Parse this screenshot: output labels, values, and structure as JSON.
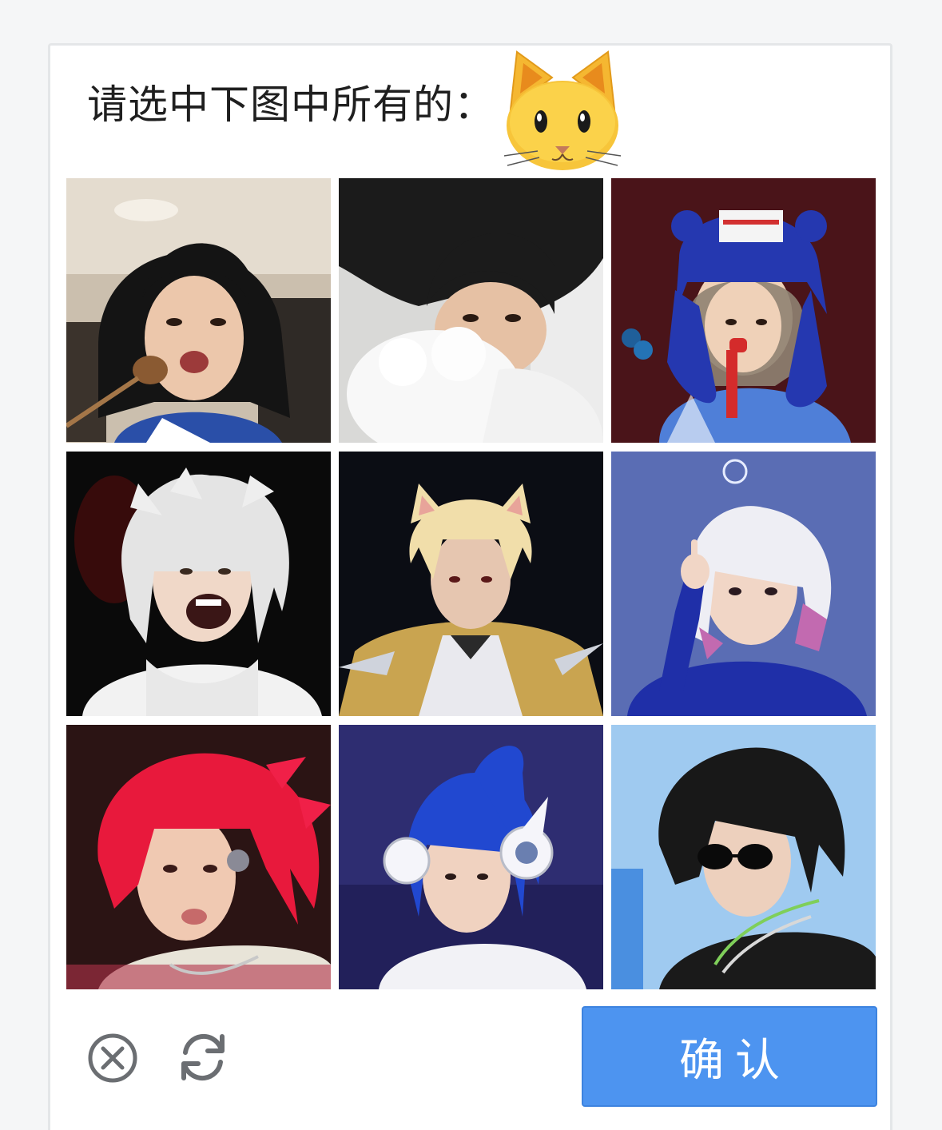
{
  "captcha": {
    "prompt": "请选中下图中所有的：",
    "target_icon": "cat-face-icon",
    "confirm_label": "确认",
    "close_icon": "close-circle-icon",
    "refresh_icon": "refresh-icon"
  },
  "tiles": [
    {
      "name": "tile-1",
      "description_icon": "person-dark-hair-eating"
    },
    {
      "name": "tile-2",
      "description_icon": "person-dark-hair-with-white-dog"
    },
    {
      "name": "tile-3",
      "description_icon": "person-blue-beanie-microphone"
    },
    {
      "name": "tile-4",
      "description_icon": "person-white-spiky-hair"
    },
    {
      "name": "tile-5",
      "description_icon": "person-blonde-cat-ears-costume"
    },
    {
      "name": "tile-6",
      "description_icon": "person-white-pink-hair-pointing"
    },
    {
      "name": "tile-7",
      "description_icon": "person-red-hair"
    },
    {
      "name": "tile-8",
      "description_icon": "person-blue-ponytail-headphones"
    },
    {
      "name": "tile-9",
      "description_icon": "person-black-hair-sunglasses"
    }
  ],
  "colors": {
    "confirm_button": "#4d94f0",
    "icon_gray": "#6b6e72"
  }
}
